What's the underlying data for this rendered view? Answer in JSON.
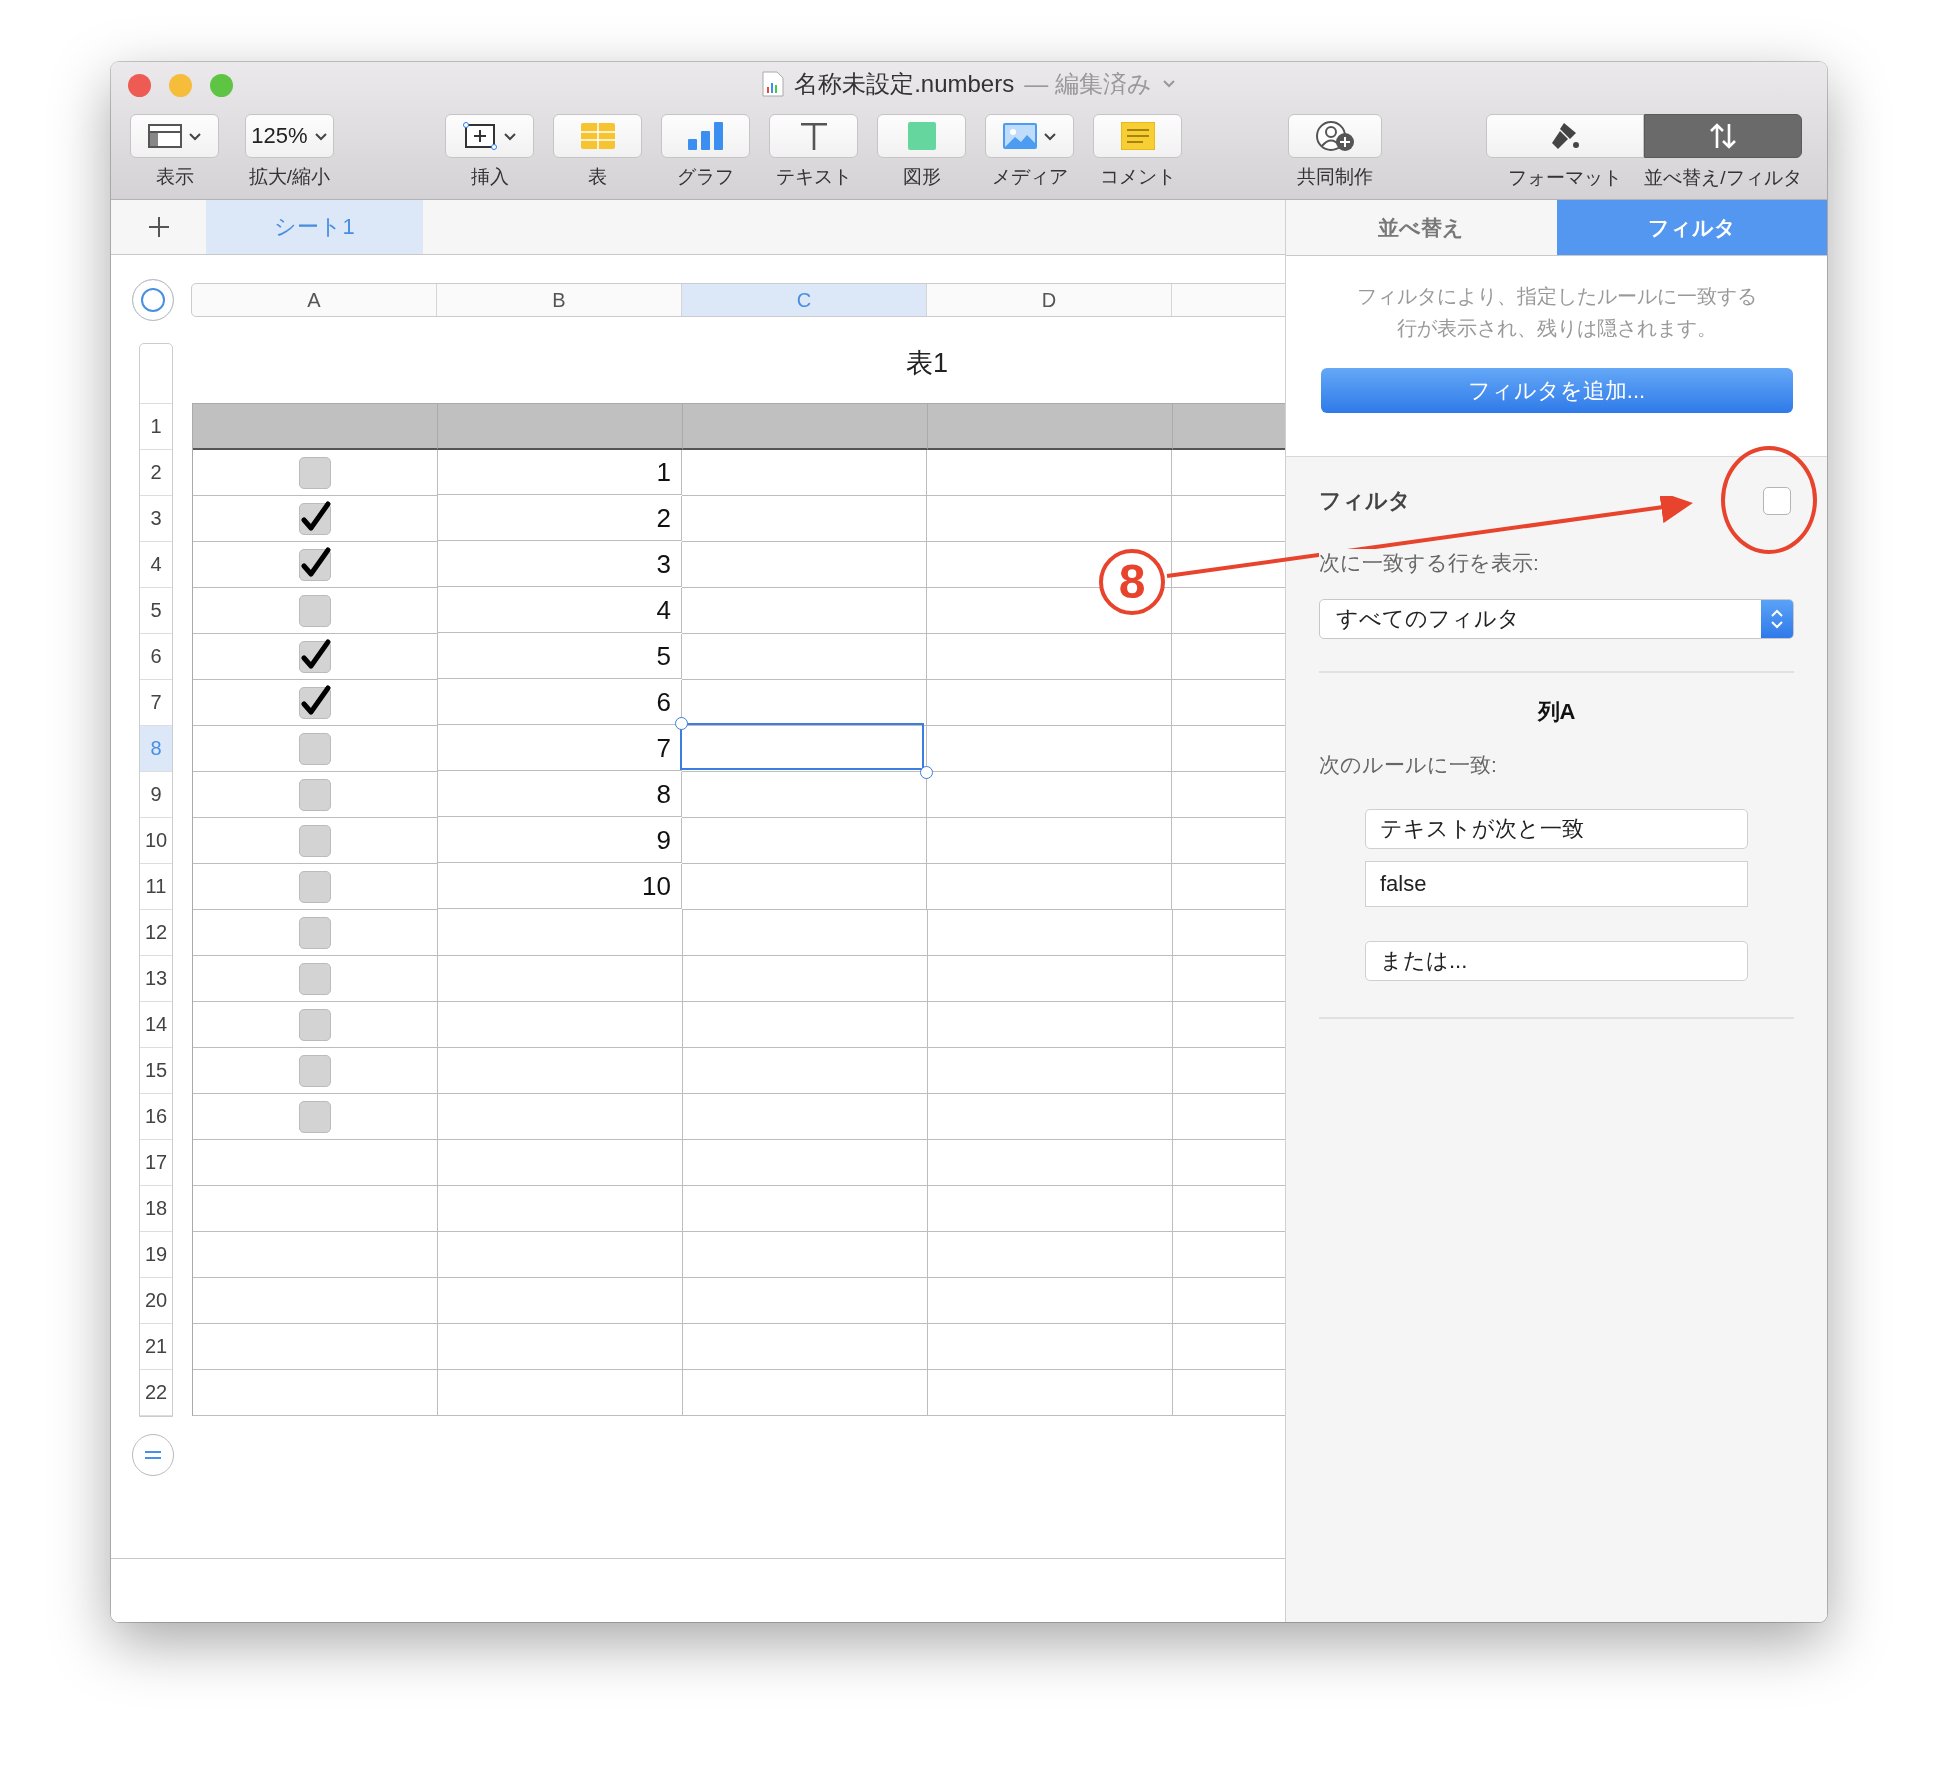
{
  "window": {
    "title": "名称未設定.numbers",
    "status": "— 編集済み"
  },
  "toolbar": {
    "left": [
      {
        "kind": "view",
        "label": "表示",
        "dropdown": true
      },
      {
        "kind": "zoom",
        "value": "125%",
        "label": "拡大/縮小",
        "dropdown": true
      }
    ],
    "center": [
      {
        "kind": "insert",
        "label": "挿入",
        "dropdown": true
      },
      {
        "kind": "table",
        "label": "表",
        "dropdown": false
      },
      {
        "kind": "chart",
        "label": "グラフ",
        "dropdown": false
      },
      {
        "kind": "text",
        "label": "テキスト",
        "dropdown": false
      },
      {
        "kind": "shape",
        "label": "図形",
        "dropdown": false
      },
      {
        "kind": "media",
        "label": "メディア",
        "dropdown": true
      },
      {
        "kind": "comment",
        "label": "コメント",
        "dropdown": false
      }
    ],
    "share": [
      {
        "kind": "collab",
        "label": "共同制作",
        "dropdown": false
      }
    ],
    "inspector": [
      {
        "kind": "format",
        "label": "フォーマット",
        "selected": false
      },
      {
        "kind": "sort",
        "label": "並べ替え/フィルタ",
        "selected": true
      }
    ]
  },
  "sheet_tabs": [
    {
      "label": "シート1",
      "selected": true
    }
  ],
  "table": {
    "title": "表1",
    "columns": [
      {
        "label": "A",
        "selected": false
      },
      {
        "label": "B",
        "selected": false
      },
      {
        "label": "C",
        "selected": true
      },
      {
        "label": "D",
        "selected": false
      }
    ],
    "rows": [
      {
        "number": "1",
        "kind": "header",
        "selected": false
      },
      {
        "number": "2",
        "kind": "body",
        "selected": false,
        "checked": false,
        "b": "1"
      },
      {
        "number": "3",
        "kind": "body",
        "selected": false,
        "checked": true,
        "b": "2"
      },
      {
        "number": "4",
        "kind": "body",
        "selected": false,
        "checked": true,
        "b": "3"
      },
      {
        "number": "5",
        "kind": "body",
        "selected": false,
        "checked": false,
        "b": "4"
      },
      {
        "number": "6",
        "kind": "body",
        "selected": false,
        "checked": true,
        "b": "5"
      },
      {
        "number": "7",
        "kind": "body",
        "selected": false,
        "checked": true,
        "b": "6"
      },
      {
        "number": "8",
        "kind": "body",
        "selected": true,
        "checked": false,
        "b": "7"
      },
      {
        "number": "9",
        "kind": "body",
        "selected": false,
        "checked": false,
        "b": "8"
      },
      {
        "number": "10",
        "kind": "body",
        "selected": false,
        "checked": false,
        "b": "9"
      },
      {
        "number": "11",
        "kind": "body",
        "selected": false,
        "checked": false,
        "b": "10"
      },
      {
        "number": "12",
        "kind": "body",
        "selected": false,
        "checked": false
      },
      {
        "number": "13",
        "kind": "body",
        "selected": false,
        "checked": false
      },
      {
        "number": "14",
        "kind": "body",
        "selected": false,
        "checked": false
      },
      {
        "number": "15",
        "kind": "body",
        "selected": false,
        "checked": false
      },
      {
        "number": "16",
        "kind": "body",
        "selected": false,
        "checked": false
      },
      {
        "number": "17",
        "kind": "body",
        "selected": false
      },
      {
        "number": "18",
        "kind": "body",
        "selected": false
      },
      {
        "number": "19",
        "kind": "body",
        "selected": false
      },
      {
        "number": "20",
        "kind": "body",
        "selected": false
      },
      {
        "number": "21",
        "kind": "body",
        "selected": false
      },
      {
        "number": "22",
        "kind": "body",
        "selected": false
      }
    ]
  },
  "sidebar": {
    "tabs": [
      {
        "label": "並べ替え",
        "selected": false
      },
      {
        "label": "フィルタ",
        "selected": true
      }
    ],
    "description": "フィルタにより、指定したルールに一致する行が表示され、残りは隠されます。",
    "add_button": "フィルタを追加...",
    "filter": {
      "title": "フィルタ",
      "checked": false,
      "show_label": "次に一致する行を表示:",
      "match_select": "すべてのフィルタ",
      "column_title": "列A",
      "rule_label": "次のルールに一致:",
      "condition": "テキストが次と一致",
      "value": "false",
      "or_button": "または..."
    }
  },
  "annotation": {
    "label": "8"
  }
}
